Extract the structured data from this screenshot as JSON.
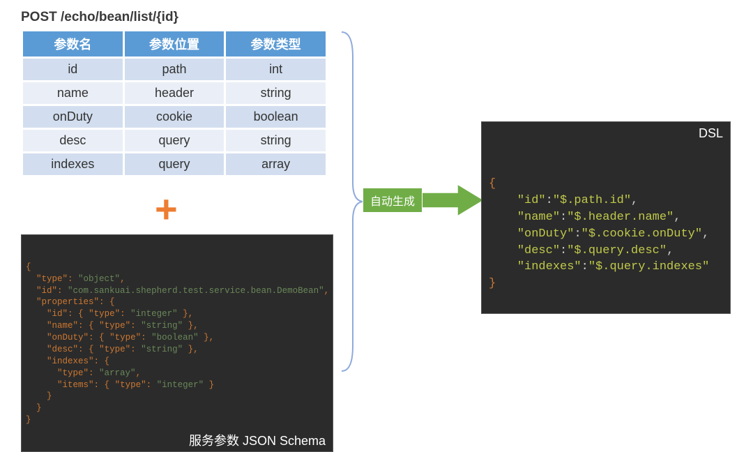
{
  "endpoint": "POST /echo/bean/list/{id}",
  "table": {
    "headers": [
      "参数名",
      "参数位置",
      "参数类型"
    ],
    "rows": [
      {
        "name": "id",
        "loc": "path",
        "type": "int"
      },
      {
        "name": "name",
        "loc": "header",
        "type": "string"
      },
      {
        "name": "onDuty",
        "loc": "cookie",
        "type": "boolean"
      },
      {
        "name": "desc",
        "loc": "query",
        "type": "string"
      },
      {
        "name": "indexes",
        "loc": "query",
        "type": "array"
      }
    ]
  },
  "plus_symbol": "+",
  "schema": {
    "caption": "服务参数 JSON Schema",
    "lines": [
      [
        [
          "brace",
          "{"
        ]
      ],
      [
        [
          "text",
          "  "
        ],
        [
          "key",
          "\"type\""
        ],
        [
          "punct",
          ": "
        ],
        [
          "string",
          "\"object\""
        ],
        [
          "punct",
          ","
        ]
      ],
      [
        [
          "text",
          "  "
        ],
        [
          "key",
          "\"id\""
        ],
        [
          "punct",
          ": "
        ],
        [
          "string",
          "\"com.sankuai.shepherd.test.service.bean.DemoBean\""
        ],
        [
          "punct",
          ","
        ]
      ],
      [
        [
          "text",
          "  "
        ],
        [
          "key",
          "\"properties\""
        ],
        [
          "punct",
          ": "
        ],
        [
          "brace",
          "{"
        ]
      ],
      [
        [
          "text",
          "    "
        ],
        [
          "key",
          "\"id\""
        ],
        [
          "punct",
          ": "
        ],
        [
          "brace",
          "{"
        ],
        [
          "punct",
          " "
        ],
        [
          "key",
          "\"type\""
        ],
        [
          "punct",
          ": "
        ],
        [
          "string",
          "\"integer\""
        ],
        [
          "punct",
          " "
        ],
        [
          "brace",
          "}"
        ],
        [
          "punct",
          ","
        ]
      ],
      [
        [
          "text",
          "    "
        ],
        [
          "key",
          "\"name\""
        ],
        [
          "punct",
          ": "
        ],
        [
          "brace",
          "{"
        ],
        [
          "punct",
          " "
        ],
        [
          "key",
          "\"type\""
        ],
        [
          "punct",
          ": "
        ],
        [
          "string",
          "\"string\""
        ],
        [
          "punct",
          " "
        ],
        [
          "brace",
          "}"
        ],
        [
          "punct",
          ","
        ]
      ],
      [
        [
          "text",
          "    "
        ],
        [
          "key",
          "\"onDuty\""
        ],
        [
          "punct",
          ": "
        ],
        [
          "brace",
          "{"
        ],
        [
          "punct",
          " "
        ],
        [
          "key",
          "\"type\""
        ],
        [
          "punct",
          ": "
        ],
        [
          "string",
          "\"boolean\""
        ],
        [
          "punct",
          " "
        ],
        [
          "brace",
          "}"
        ],
        [
          "punct",
          ","
        ]
      ],
      [
        [
          "text",
          "    "
        ],
        [
          "key",
          "\"desc\""
        ],
        [
          "punct",
          ": "
        ],
        [
          "brace",
          "{"
        ],
        [
          "punct",
          " "
        ],
        [
          "key",
          "\"type\""
        ],
        [
          "punct",
          ": "
        ],
        [
          "string",
          "\"string\""
        ],
        [
          "punct",
          " "
        ],
        [
          "brace",
          "}"
        ],
        [
          "punct",
          ","
        ]
      ],
      [
        [
          "text",
          "    "
        ],
        [
          "key",
          "\"indexes\""
        ],
        [
          "punct",
          ": "
        ],
        [
          "brace",
          "{"
        ]
      ],
      [
        [
          "text",
          "      "
        ],
        [
          "key",
          "\"type\""
        ],
        [
          "punct",
          ": "
        ],
        [
          "string",
          "\"array\""
        ],
        [
          "punct",
          ","
        ]
      ],
      [
        [
          "text",
          "      "
        ],
        [
          "key",
          "\"items\""
        ],
        [
          "punct",
          ": "
        ],
        [
          "brace",
          "{"
        ],
        [
          "punct",
          " "
        ],
        [
          "key",
          "\"type\""
        ],
        [
          "punct",
          ": "
        ],
        [
          "string",
          "\"integer\""
        ],
        [
          "punct",
          " "
        ],
        [
          "brace",
          "}"
        ]
      ],
      [
        [
          "text",
          "    "
        ],
        [
          "brace",
          "}"
        ]
      ],
      [
        [
          "text",
          "  "
        ],
        [
          "brace",
          "}"
        ]
      ],
      [
        [
          "brace",
          "}"
        ]
      ]
    ]
  },
  "arrow_label": "自动生成",
  "dsl": {
    "caption": "DSL",
    "lines": [
      [
        [
          "dsl-brace",
          "{"
        ]
      ],
      [
        [
          "text",
          "    "
        ],
        [
          "dsl-key",
          "\"id\""
        ],
        [
          "dsl-punct",
          ":"
        ],
        [
          "dsl-string",
          "\"$.path.id\""
        ],
        [
          "dsl-punct",
          ","
        ]
      ],
      [
        [
          "text",
          "    "
        ],
        [
          "dsl-key",
          "\"name\""
        ],
        [
          "dsl-punct",
          ":"
        ],
        [
          "dsl-string",
          "\"$.header.name\""
        ],
        [
          "dsl-punct",
          ","
        ]
      ],
      [
        [
          "text",
          "    "
        ],
        [
          "dsl-key",
          "\"onDuty\""
        ],
        [
          "dsl-punct",
          ":"
        ],
        [
          "dsl-string",
          "\"$.cookie.onDuty\""
        ],
        [
          "dsl-punct",
          ","
        ]
      ],
      [
        [
          "text",
          "    "
        ],
        [
          "dsl-key",
          "\"desc\""
        ],
        [
          "dsl-punct",
          ":"
        ],
        [
          "dsl-string",
          "\"$.query.desc\""
        ],
        [
          "dsl-punct",
          ","
        ]
      ],
      [
        [
          "text",
          "    "
        ],
        [
          "dsl-key",
          "\"indexes\""
        ],
        [
          "dsl-punct",
          ":"
        ],
        [
          "dsl-string",
          "\"$.query.indexes\""
        ]
      ],
      [
        [
          "dsl-brace",
          "}"
        ]
      ]
    ]
  }
}
